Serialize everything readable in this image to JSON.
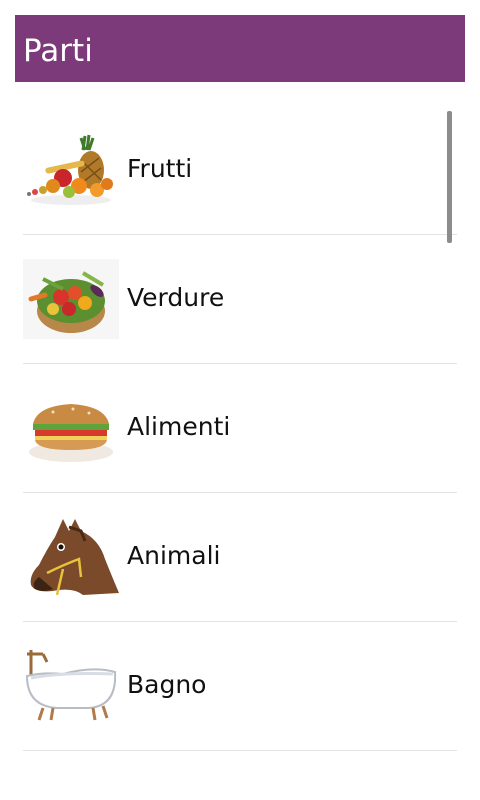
{
  "header": {
    "title": "Parti"
  },
  "theme": {
    "accent": "#7d3a7a"
  },
  "categories": [
    {
      "label": "Frutti",
      "icon": "fruit-basket-icon"
    },
    {
      "label": "Verdure",
      "icon": "vegetable-bowl-icon"
    },
    {
      "label": "Alimenti",
      "icon": "sandwich-icon"
    },
    {
      "label": "Animali",
      "icon": "horse-head-icon"
    },
    {
      "label": "Bagno",
      "icon": "bathtub-icon"
    }
  ]
}
